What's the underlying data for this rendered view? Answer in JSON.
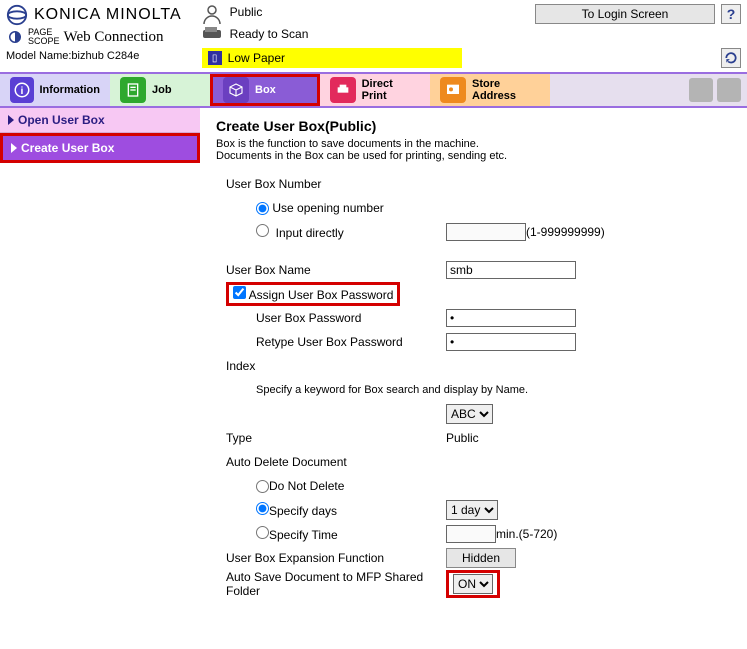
{
  "brand": "KONICA MINOLTA",
  "pagescope_small": "PAGE\nSCOPE",
  "pagescope": "Web Connection",
  "model_label": "Model Name:",
  "model_value": "bizhub C284e",
  "user_label": "Public",
  "status_ready": "Ready to Scan",
  "status_lowpaper": "Low Paper",
  "login_btn": "To Login Screen",
  "help": "?",
  "tabs": {
    "info": "Information",
    "job": "Job",
    "box": "Box",
    "direct": "Direct Print",
    "store1": "Store",
    "store2": "Address"
  },
  "side": {
    "open": "Open User Box",
    "create": "Create User Box"
  },
  "page": {
    "title": "Create User Box(Public)",
    "desc1": "Box is the function to save documents in the machine.",
    "desc2": "Documents in the Box can be used for printing, sending etc.",
    "userboxnum": "User Box Number",
    "useopening": "Use opening number",
    "inputdirectly": "Input directly",
    "numrange": "(1-999999999)",
    "userboxname": "User Box Name",
    "userboxname_val": "smb",
    "assignpw": "Assign User Box Password",
    "userboxpw": "User Box Password",
    "retypepw": "Retype User Box Password",
    "pw_dot": "•",
    "index": "Index",
    "index_hint": "Specify a keyword for Box search and display by Name.",
    "index_val": "ABC",
    "type": "Type",
    "type_val": "Public",
    "autodel": "Auto Delete Document",
    "donotdelete": "Do Not Delete",
    "specifydays": "Specify days",
    "specifydays_val": "1 day",
    "specifytime": "Specify Time",
    "specifytime_range": "min.(5-720)",
    "expansion": "User Box Expansion Function",
    "hidden": "Hidden",
    "autosave": "Auto Save Document to MFP Shared Folder",
    "autosave_val": "ON"
  }
}
